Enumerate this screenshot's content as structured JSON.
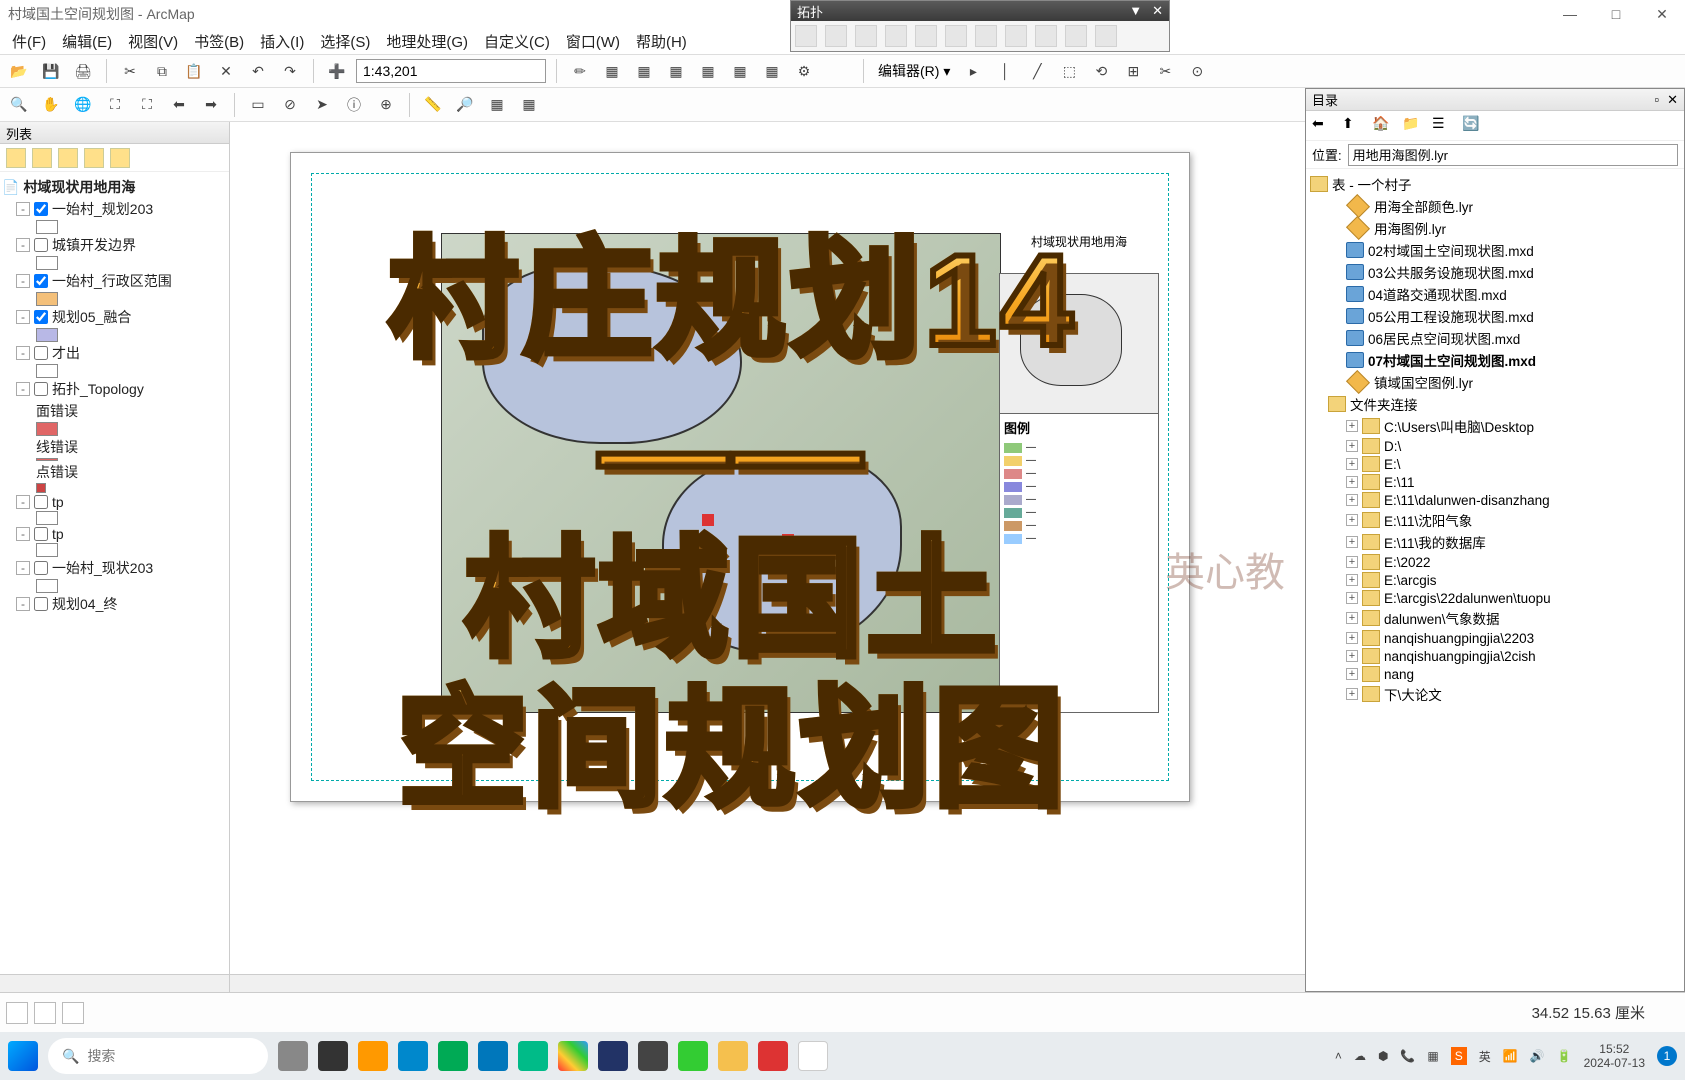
{
  "window": {
    "title": "村域国土空间规划图 - ArcMap"
  },
  "winbuttons": {
    "min": "—",
    "max": "□",
    "close": "✕"
  },
  "topology": {
    "title": "拓扑",
    "btns": [
      "▼",
      "✕"
    ]
  },
  "menu": [
    "件(F)",
    "编辑(E)",
    "视图(V)",
    "书签(B)",
    "插入(I)",
    "选择(S)",
    "地理处理(G)",
    "自定义(C)",
    "窗口(W)",
    "帮助(H)"
  ],
  "scale": "1:43,201",
  "editor_label": "编辑器(R)",
  "toc": {
    "title": "列表",
    "root": "村域现状用地用海",
    "items": [
      {
        "exp": "-",
        "chk": true,
        "label": "一始村_规划203",
        "swatch": "#ffffff"
      },
      {
        "exp": "-",
        "chk": false,
        "label": "城镇开发边界",
        "swatch": "#ffffff"
      },
      {
        "exp": "-",
        "chk": true,
        "label": "一始村_行政区范围",
        "swatch": "#f4c07a"
      },
      {
        "exp": "-",
        "chk": true,
        "label": "规划05_融合",
        "swatch": "#b8b8e6"
      },
      {
        "exp": "-",
        "chk": false,
        "label": "才出",
        "swatch": "#ffffff"
      },
      {
        "exp": "-",
        "chk": false,
        "label": "拓扑_Topology",
        "children": [
          {
            "label": "面错误",
            "swatch": "#e06666"
          },
          {
            "label": "线错误",
            "swatch": "#e06666"
          },
          {
            "label": "点错误",
            "swatch": "#c44"
          }
        ]
      },
      {
        "exp": "-",
        "chk": false,
        "label": "tp",
        "swatch": "#ffffff"
      },
      {
        "exp": "-",
        "chk": false,
        "label": "tp",
        "swatch": "#ffffff"
      },
      {
        "exp": "-",
        "chk": false,
        "label": "一始村_现状203",
        "swatch": "#ffffff"
      },
      {
        "exp": "-",
        "chk": false,
        "label": "规划04_终"
      }
    ]
  },
  "map": {
    "layout_title": "村域现状用地用海",
    "legend_title": "图例"
  },
  "catalog": {
    "title": "目录",
    "location_label": "位置:",
    "location_value": "用地用海图例.lyr",
    "root": "表 - 一个村子",
    "files": [
      {
        "type": "lyr",
        "name": "用海全部颜色.lyr"
      },
      {
        "type": "lyr",
        "name": "用海图例.lyr"
      },
      {
        "type": "mxd",
        "name": "02村域国土空间现状图.mxd"
      },
      {
        "type": "mxd",
        "name": "03公共服务设施现状图.mxd"
      },
      {
        "type": "mxd",
        "name": "04道路交通现状图.mxd"
      },
      {
        "type": "mxd",
        "name": "05公用工程设施现状图.mxd"
      },
      {
        "type": "mxd",
        "name": "06居民点空间现状图.mxd"
      },
      {
        "type": "mxd",
        "name": "07村域国土空间规划图.mxd",
        "bold": true
      },
      {
        "type": "lyr",
        "name": "镇域国空图例.lyr"
      }
    ],
    "folder_conn_label": "文件夹连接",
    "folders": [
      "C:\\Users\\叫电脑\\Desktop",
      "D:\\",
      "E:\\",
      "E:\\11",
      "E:\\11\\dalunwen-disanzhang",
      "E:\\11\\沈阳气象",
      "E:\\11\\我的数据库",
      "E:\\2022",
      "E:\\arcgis",
      "E:\\arcgis\\22dalunwen\\tuopu",
      "dalunwen\\气象数据",
      "nanqishuangpingjia\\2203",
      "nanqishuangpingjia\\2cish",
      "nang",
      "下\\大论文"
    ]
  },
  "status": {
    "coords": "34.52 15.63 厘米"
  },
  "taskbar": {
    "search_placeholder": "搜索",
    "time": "15:52",
    "date": "2024-07-13"
  },
  "overlay": {
    "line1": "村庄规划14",
    "line2": "——",
    "line3": "村域国土",
    "line4": "空间规划图"
  },
  "watermark": "英心教"
}
